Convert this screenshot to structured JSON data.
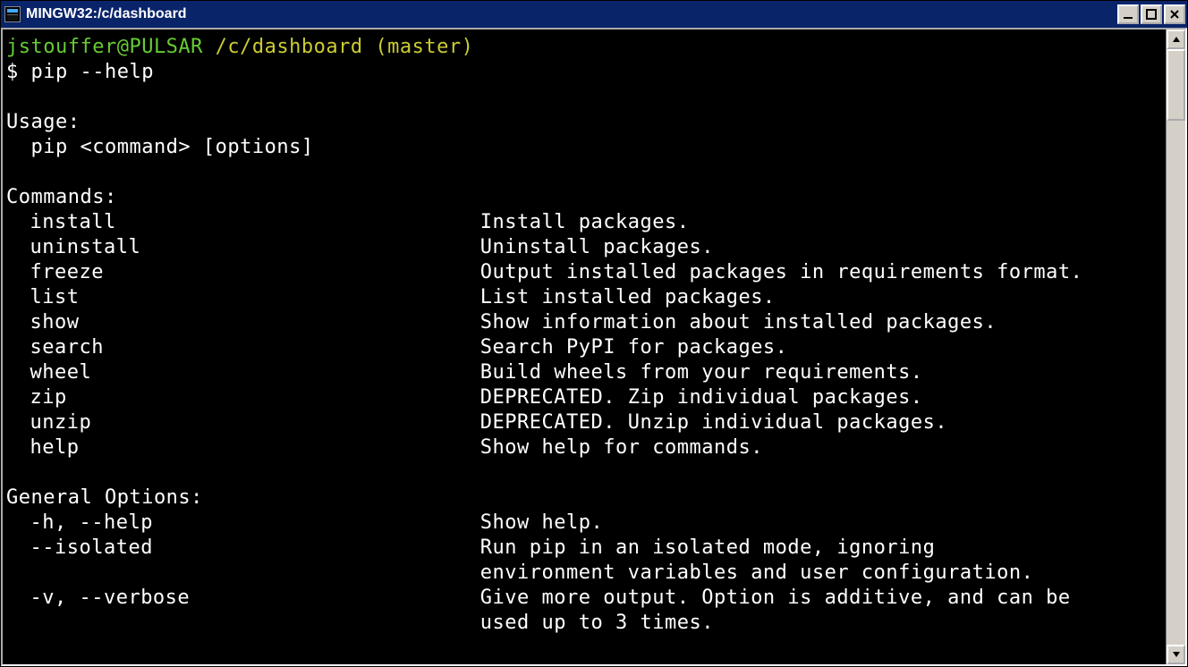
{
  "window": {
    "title": "MINGW32:/c/dashboard"
  },
  "prompt": {
    "user_host": "jstouffer@PULSAR",
    "path_branch": "/c/dashboard (master)",
    "symbol": "$",
    "command": "pip --help"
  },
  "usage_header": "Usage:",
  "usage_line": "  pip <command> [options]",
  "commands_header": "Commands:",
  "commands": [
    {
      "name": "install",
      "desc": "Install packages."
    },
    {
      "name": "uninstall",
      "desc": "Uninstall packages."
    },
    {
      "name": "freeze",
      "desc": "Output installed packages in requirements format."
    },
    {
      "name": "list",
      "desc": "List installed packages."
    },
    {
      "name": "show",
      "desc": "Show information about installed packages."
    },
    {
      "name": "search",
      "desc": "Search PyPI for packages."
    },
    {
      "name": "wheel",
      "desc": "Build wheels from your requirements."
    },
    {
      "name": "zip",
      "desc": "DEPRECATED. Zip individual packages."
    },
    {
      "name": "unzip",
      "desc": "DEPRECATED. Unzip individual packages."
    },
    {
      "name": "help",
      "desc": "Show help for commands."
    }
  ],
  "general_header": "General Options:",
  "options": [
    {
      "flags": "-h, --help",
      "desc_lines": [
        "Show help."
      ]
    },
    {
      "flags": "--isolated",
      "desc_lines": [
        "Run pip in an isolated mode, ignoring",
        "environment variables and user configuration."
      ]
    },
    {
      "flags": "-v, --verbose",
      "desc_lines": [
        "Give more output. Option is additive, and can be",
        "used up to 3 times."
      ]
    }
  ]
}
